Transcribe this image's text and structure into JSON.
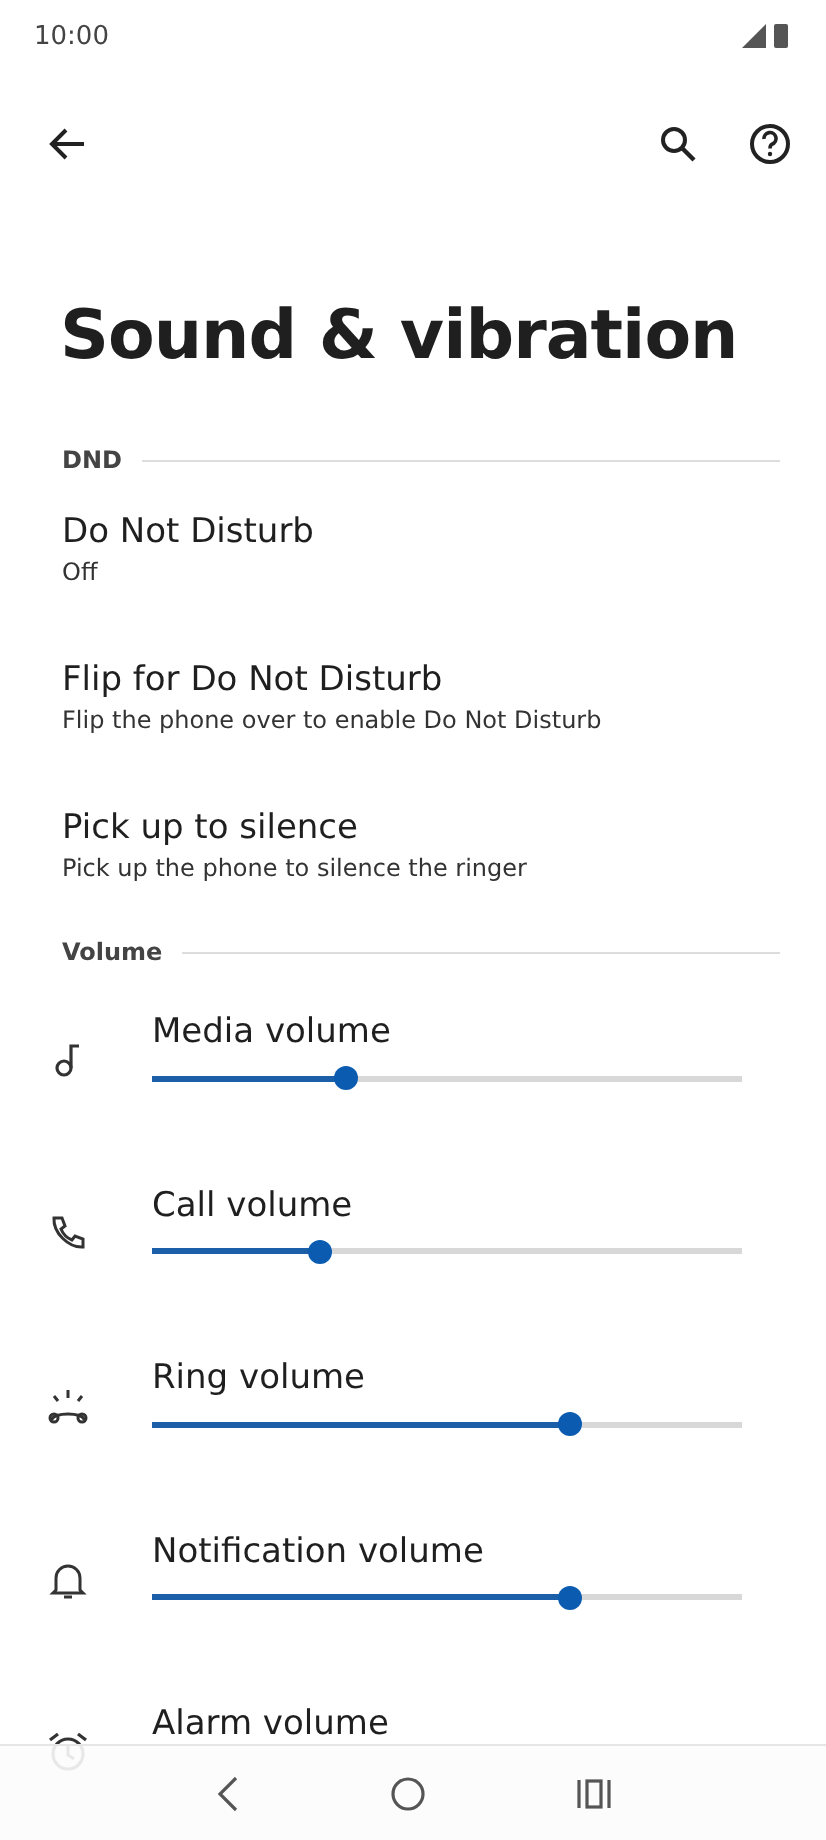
{
  "status_bar": {
    "time": "10:00"
  },
  "title": "Sound & vibration",
  "sections": [
    {
      "header": "DND",
      "items": [
        {
          "title": "Do Not Disturb",
          "summary": "Off"
        },
        {
          "title": "Flip for Do Not Disturb",
          "summary": "Flip the phone over to enable Do Not Disturb"
        },
        {
          "title": "Pick up to silence",
          "summary": "Pick up the phone to silence the ringer"
        }
      ]
    },
    {
      "header": "Volume"
    }
  ],
  "volumes": [
    {
      "kind": "music",
      "label": "Media volume",
      "level": 0.33
    },
    {
      "kind": "call",
      "label": "Call volume",
      "level": 0.285
    },
    {
      "kind": "ring",
      "label": "Ring volume",
      "level": 0.71
    },
    {
      "kind": "notification",
      "label": "Notification volume",
      "level": 0.71
    },
    {
      "kind": "alarm",
      "label": "Alarm volume"
    }
  ]
}
